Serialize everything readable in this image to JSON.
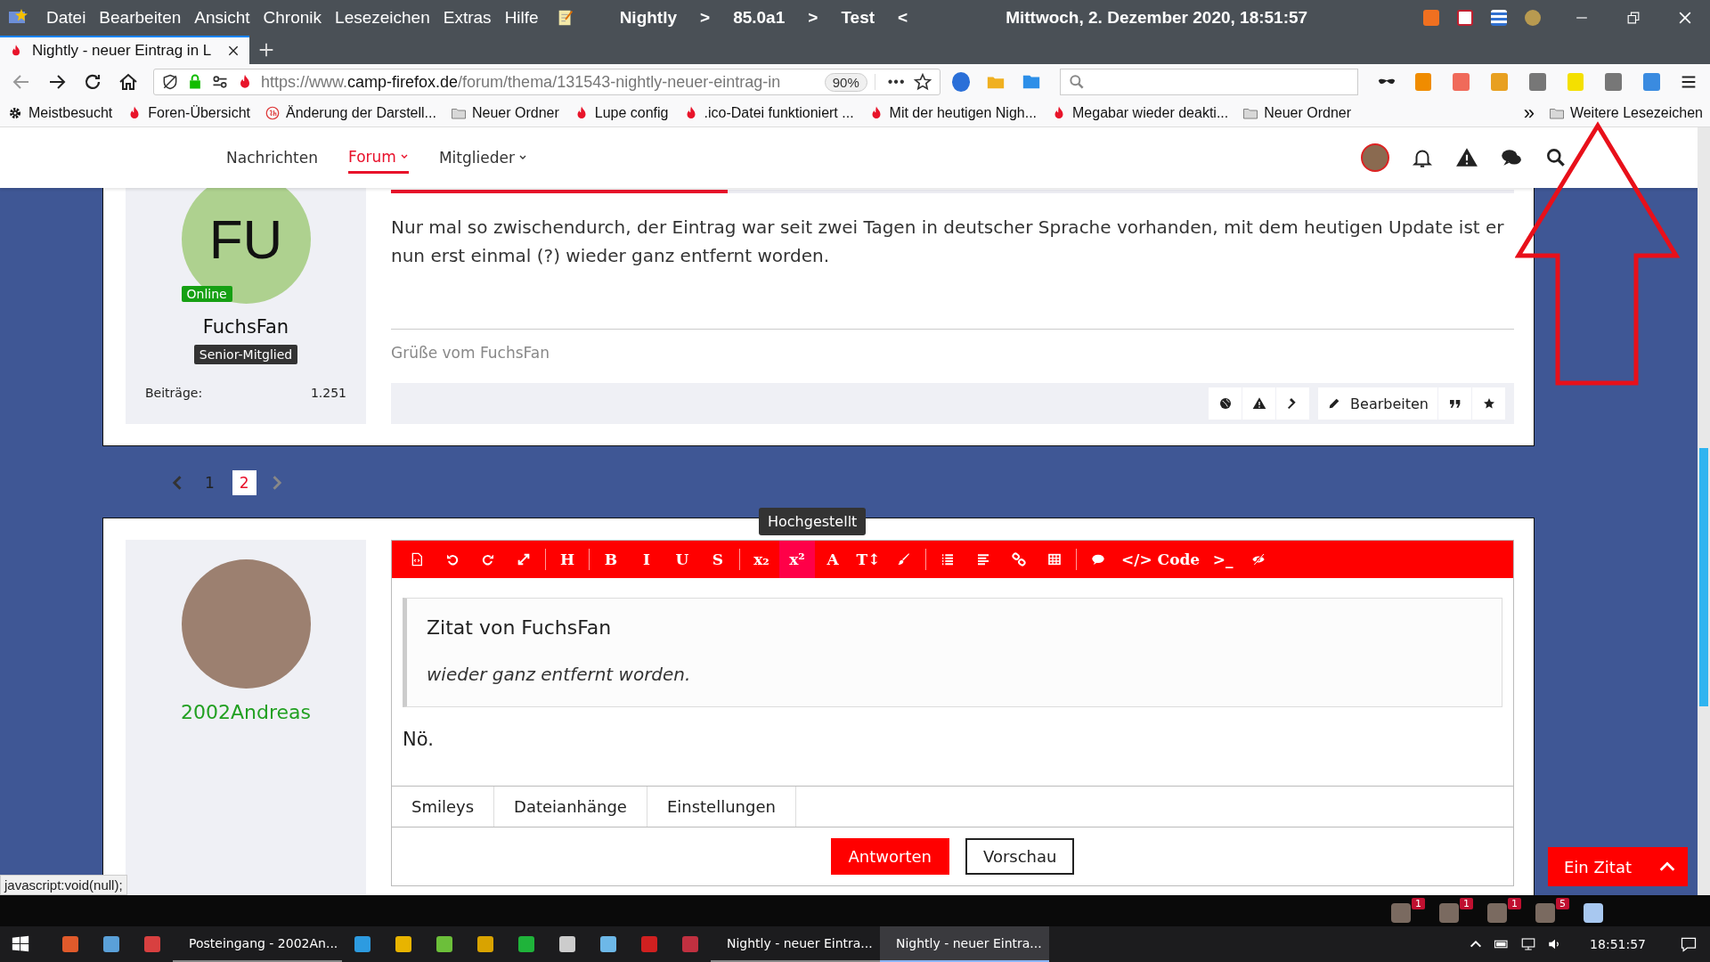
{
  "title_bar": {
    "menu": [
      "Datei",
      "Bearbeiten",
      "Ansicht",
      "Chronik",
      "Lesezeichen",
      "Extras",
      "Hilfe"
    ],
    "segments": [
      "Nightly",
      ">",
      "85.0a1",
      ">",
      "Test",
      "<"
    ],
    "datetime": "Mittwoch, 2. Dezember 2020, 18:51:57"
  },
  "tabs": [
    {
      "title": "Nightly - neuer Eintrag in L",
      "selected": true
    }
  ],
  "nav_bar": {
    "url_prefix": "https://www.",
    "url_domain": "camp-firefox.de",
    "url_path": "/forum/thema/131543-nightly-neuer-eintrag-in",
    "zoom": "90%",
    "menu_dots": "•••"
  },
  "bookmarks": [
    {
      "kind": "gear",
      "label": "Meistbesucht"
    },
    {
      "kind": "flame",
      "label": "Foren-Übersicht"
    },
    {
      "kind": "badge",
      "label": "Änderung der Darstell..."
    },
    {
      "kind": "folder",
      "label": "Neuer Ordner"
    },
    {
      "kind": "flame",
      "label": "Lupe config"
    },
    {
      "kind": "flame",
      "label": ".ico-Datei funktioniert ..."
    },
    {
      "kind": "flame",
      "label": "Mit der heutigen Nigh..."
    },
    {
      "kind": "flame",
      "label": "Megabar wieder deakti..."
    },
    {
      "kind": "folder",
      "label": "Neuer Ordner"
    }
  ],
  "bookmarks_more": {
    "chevron": "»",
    "label": "Weitere Lesezeichen"
  },
  "site_nav": [
    {
      "label": "Nachrichten",
      "selected": false,
      "dropdown": false
    },
    {
      "label": "Forum",
      "selected": true,
      "dropdown": true
    },
    {
      "label": "Mitglieder",
      "selected": false,
      "dropdown": true
    }
  ],
  "post": {
    "initials": "FU",
    "online": "Online",
    "author": "FuchsFan",
    "rank": "Senior-Mitglied",
    "stat_label": "Beiträge:",
    "stat_value": "1.251",
    "reading_progress": {
      "level": 0.3
    },
    "message": "Nur mal so zwischendurch, der Eintrag war seit zwei Tagen in deutscher Sprache vorhanden, mit dem heutigen Update ist er nun erst einmal (?) wieder ganz entfernt worden.",
    "signature": "Grüße vom FuchsFan",
    "edit": "Bearbeiten"
  },
  "pagination": [
    {
      "label": "1",
      "selected": false
    },
    {
      "label": "2",
      "selected": true
    }
  ],
  "reply": {
    "author": "2002Andreas",
    "tooltip": "Hochgestellt",
    "toolbar": [
      [
        {
          "kind": "icon",
          "selected": false
        },
        {
          "kind": "icon",
          "selected": false
        },
        {
          "kind": "icon",
          "selected": false
        },
        {
          "kind": "icon",
          "selected": false
        }
      ],
      [
        {
          "kind": "glyph",
          "label": "H",
          "selected": false
        }
      ],
      [
        {
          "kind": "glyph",
          "label": "B",
          "selected": false
        },
        {
          "kind": "glyph",
          "label": "I",
          "selected": false
        },
        {
          "kind": "glyph",
          "label": "U",
          "selected": false
        },
        {
          "kind": "glyph",
          "label": "S",
          "selected": false
        }
      ],
      [
        {
          "kind": "glyph",
          "label": "x₂",
          "selected": false
        },
        {
          "kind": "glyph",
          "label": "x²",
          "selected": true
        },
        {
          "kind": "glyph",
          "label": "A",
          "selected": false
        },
        {
          "kind": "glyph",
          "label": "T↕",
          "selected": false
        },
        {
          "kind": "icon",
          "selected": false
        }
      ],
      [
        {
          "kind": "icon",
          "selected": false
        },
        {
          "kind": "icon",
          "selected": false
        },
        {
          "kind": "icon",
          "selected": false
        },
        {
          "kind": "icon",
          "selected": false
        }
      ],
      [
        {
          "kind": "icon",
          "selected": false
        },
        {
          "kind": "glyph",
          "label": "</> Code",
          "selected": false
        },
        {
          "kind": "glyph",
          "label": ">_",
          "selected": false
        },
        {
          "kind": "icon",
          "selected": false
        }
      ]
    ],
    "quote_title": "Zitat von FuchsFan",
    "quote_text": "wieder ganz entfernt worden.",
    "text": "Nö.",
    "tabs": [
      "Smileys",
      "Dateianhänge",
      "Einstellungen"
    ],
    "buttons": [
      {
        "label": "Antworten",
        "kind": "primary"
      },
      {
        "label": "Vorschau",
        "kind": "secondary"
      }
    ]
  },
  "floating": {
    "quote_button": "Ein Zitat"
  },
  "status_text": "javascript:void(null);",
  "tray_badges": [
    "1",
    "1",
    "1",
    "5"
  ],
  "taskbar": [
    {
      "kind": "app"
    },
    {
      "kind": "app"
    },
    {
      "kind": "app"
    },
    {
      "kind": "window",
      "label": "Posteingang - 2002An...",
      "selected": false
    },
    {
      "kind": "app"
    },
    {
      "kind": "app"
    },
    {
      "kind": "app"
    },
    {
      "kind": "app"
    },
    {
      "kind": "app"
    },
    {
      "kind": "app"
    },
    {
      "kind": "app"
    },
    {
      "kind": "app"
    },
    {
      "kind": "app"
    },
    {
      "kind": "window",
      "label": "Nightly - neuer Eintra...",
      "selected": false
    },
    {
      "kind": "window",
      "label": "Nightly - neuer Eintra...",
      "selected": true
    }
  ],
  "clock": "18:51:57"
}
